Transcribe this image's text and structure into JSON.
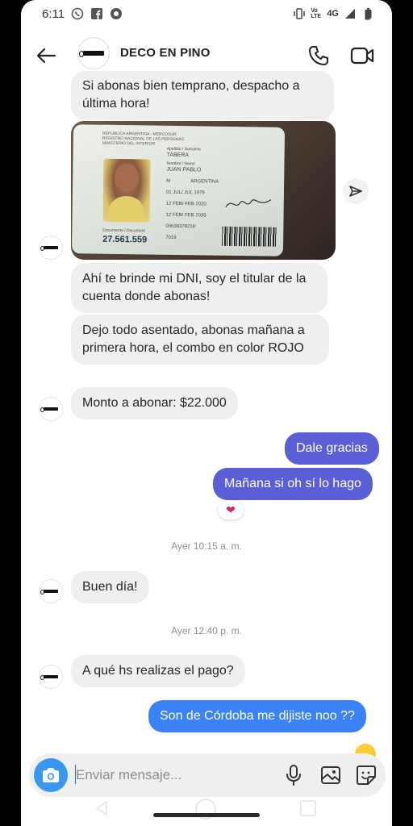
{
  "status_bar": {
    "time": "6:11",
    "network": "4G",
    "volte": "Vo LTE"
  },
  "header": {
    "contact_name": "DECO EN PINO"
  },
  "messages": [
    {
      "text": "Si abonas bien temprano, despacho a última hora!",
      "direction": "in"
    },
    {
      "type": "image",
      "direction": "in"
    },
    {
      "text": "Ahí te brinde mi DNI, soy el titular de la cuenta donde abonas!",
      "direction": "in"
    },
    {
      "text": "Dejo todo asentado, abonas mañana a primera hora, el combo en color ROJO",
      "direction": "in"
    },
    {
      "text": "Monto a abonar: $22.000",
      "direction": "in"
    },
    {
      "text": "Dale gracias",
      "direction": "out"
    },
    {
      "text": "Mañana si oh sí lo hago",
      "direction": "out",
      "reaction": "heart"
    },
    {
      "text": "Buen día!",
      "direction": "in"
    },
    {
      "text": "A qué hs realizas el pago?",
      "direction": "in"
    },
    {
      "text": "Son de Córdoba me dijiste noo ??",
      "direction": "out"
    }
  ],
  "timestamps": [
    "Ayer 10:15 a. m.",
    "Ayer 12:40 p. m."
  ],
  "id_card": {
    "header": "REPUBLICA ARGENTINA - MERCOSUR",
    "registry": "REGISTRO NACIONAL DE LAS PERSONAS",
    "ministry": "MINISTERIO DEL INTERIOR",
    "surname_label": "Apellido / Surname",
    "surname": "TABERA",
    "name_label": "Nombre / Name",
    "name": "JUAN PABLO",
    "sex": "M",
    "nationality": "ARGENTINA",
    "birth_date": "01 JUL/ JUL 1979",
    "issue_date": "12 FEB/ FEB 2020",
    "expiry_date": "12 FEB/ FEB 2035",
    "document_label": "Documento / Document",
    "document_number": "27.561.559",
    "extra_code": "00638378218",
    "extra_year": "7019"
  },
  "composer": {
    "placeholder": "Enviar mensaje..."
  },
  "colors": {
    "outgoing_bubble": "#5b5fd6",
    "outgoing_bubble_blue": "#3b82f6",
    "incoming_bubble": "#efefef",
    "camera_button": "#3897f0"
  },
  "icons": [
    "back-arrow-icon",
    "phone-icon",
    "video-camera-icon",
    "share-arrow-icon",
    "camera-icon",
    "microphone-icon",
    "gallery-icon",
    "sticker-icon",
    "close-icon",
    "heart-icon"
  ]
}
